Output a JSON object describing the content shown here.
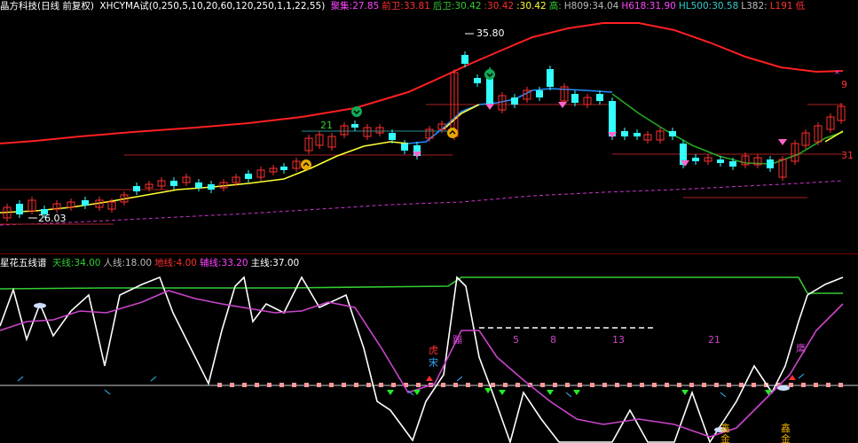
{
  "header": {
    "stock_name": "晶方科技(日线 前复权)",
    "indicator_name": "XHCYMA试(0,250,5,10,20,60,120,250,1,1,22,55)",
    "items": [
      {
        "label": "聚集:",
        "value": "27.85",
        "label_color": "#ff44ff",
        "value_color": "#ff44ff"
      },
      {
        "label": "前卫:",
        "value": "33.81",
        "label_color": "#ff3030",
        "value_color": "#ff3030"
      },
      {
        "label": "后卫:",
        "value": "30.42",
        "label_color": "#33cc33",
        "value_color": "#33cc33"
      },
      {
        "label": ":",
        "value": "30.42",
        "label_color": "#ff3030",
        "value_color": "#ff3030"
      },
      {
        "label": ":",
        "value": "30.42",
        "label_color": "#ffff33",
        "value_color": "#ffff33"
      },
      {
        "label": "高:",
        "value": "",
        "label_color": "#33cc33",
        "value_color": "#33cc33"
      },
      {
        "label": "H809:",
        "value": "34.04",
        "label_color": "#bbbbbb",
        "value_color": "#bbbbbb"
      },
      {
        "label": "H618:",
        "value": "31.90",
        "label_color": "#ff44ff",
        "value_color": "#ff44ff"
      },
      {
        "label": "HL500:",
        "value": "30.58",
        "label_color": "#33cccc",
        "value_color": "#33cccc"
      },
      {
        "label": "L382:",
        "value": "",
        "label_color": "#bbbbbb",
        "value_color": "#bbbbbb"
      },
      {
        "label": "L191",
        "value": "",
        "label_color": "#ff3030",
        "value_color": "#ff3030"
      },
      {
        "label": "低",
        "value": "",
        "label_color": "#ff3030",
        "value_color": "#ff3030"
      }
    ]
  },
  "main_chart": {
    "price_high_label": "35.80",
    "price_low_label": "26.03",
    "markers": [
      "21",
      "9",
      "31"
    ]
  },
  "indicator": {
    "title": "星花五线谱",
    "items": [
      {
        "label": "天线:",
        "value": "34.00",
        "color": "#33cc33"
      },
      {
        "label": "人线:",
        "value": "18.00",
        "color": "#bbbbbb"
      },
      {
        "label": "地线:",
        "value": "4.00",
        "color": "#ff3030"
      },
      {
        "label": "辅线:",
        "value": "33.20",
        "color": "#ff44ff"
      },
      {
        "label": "主线:",
        "value": "37.00",
        "color": "#ffffff"
      }
    ],
    "annotations": [
      "虎",
      "宋",
      "蹦",
      "5",
      "8",
      "13",
      "21",
      "鹰",
      "鑫",
      "金",
      "鑫",
      "金"
    ]
  },
  "colors": {
    "up": "#ff3030",
    "down": "#33ffff",
    "ma_short": "#ffff33",
    "ma_mid": "#1e8fff",
    "ma_green": "#22aa22",
    "boll_upper": "#ff2020",
    "dashed": "#cc33cc",
    "grid": "#7a0000"
  }
}
